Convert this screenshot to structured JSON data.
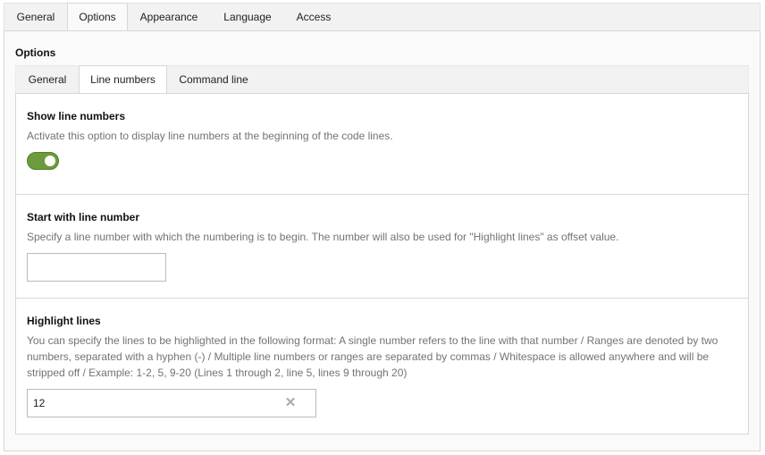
{
  "outer_tabs": [
    {
      "label": "General",
      "active": false
    },
    {
      "label": "Options",
      "active": true
    },
    {
      "label": "Appearance",
      "active": false
    },
    {
      "label": "Language",
      "active": false
    },
    {
      "label": "Access",
      "active": false
    }
  ],
  "section": {
    "title": "Options"
  },
  "inner_tabs": [
    {
      "label": "General",
      "active": false
    },
    {
      "label": "Line numbers",
      "active": true
    },
    {
      "label": "Command line",
      "active": false
    }
  ],
  "fields": {
    "show_line_numbers": {
      "label": "Show line numbers",
      "description": "Activate this option to display line numbers at the beginning of the code lines.",
      "enabled": true
    },
    "start_line_number": {
      "label": "Start with line number",
      "description": "Specify a line number with which the numbering is to begin. The number will also be used for \"Highlight lines\" as offset value.",
      "value": ""
    },
    "highlight_lines": {
      "label": "Highlight lines",
      "description": "You can specify the lines to be highlighted in the following format: A single number refers to the line with that number / Ranges are denoted by two numbers, separated with a hyphen (-) / Multiple line numbers or ranges are separated by commas / Whitespace is allowed anywhere and will be stripped off / Example: 1-2, 5, 9-20 (Lines 1 through 2, line 5, lines 9 through 20)",
      "value": "12"
    }
  },
  "icons": {
    "clear": "close-icon"
  },
  "colors": {
    "toggle_on": "#6b9b3a"
  }
}
